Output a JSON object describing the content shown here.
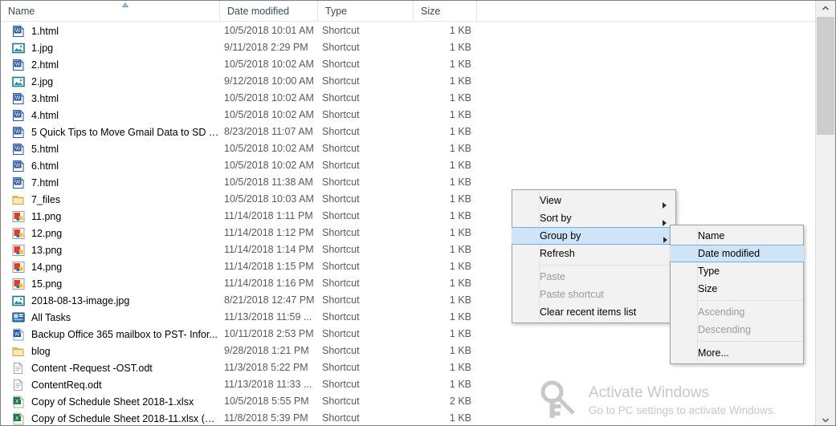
{
  "columns": [
    {
      "label": "Name",
      "key": "name"
    },
    {
      "label": "Date modified",
      "key": "date"
    },
    {
      "label": "Type",
      "key": "type"
    },
    {
      "label": "Size",
      "key": "size"
    }
  ],
  "sort": {
    "column": "Name",
    "direction": "ascending",
    "marker_icon": "sort-ascending-icon"
  },
  "files": [
    {
      "name": "1.html",
      "date": "10/5/2018 10:01 AM",
      "type": "Shortcut",
      "size": "1 KB",
      "icon": "word-html-icon"
    },
    {
      "name": "1.jpg",
      "date": "9/11/2018 2:29 PM",
      "type": "Shortcut",
      "size": "1 KB",
      "icon": "image-jpg-icon"
    },
    {
      "name": "2.html",
      "date": "10/5/2018 10:02 AM",
      "type": "Shortcut",
      "size": "1 KB",
      "icon": "word-html-icon"
    },
    {
      "name": "2.jpg",
      "date": "9/12/2018 10:00 AM",
      "type": "Shortcut",
      "size": "1 KB",
      "icon": "image-jpg-icon"
    },
    {
      "name": "3.html",
      "date": "10/5/2018 10:02 AM",
      "type": "Shortcut",
      "size": "1 KB",
      "icon": "word-html-icon"
    },
    {
      "name": "4.html",
      "date": "10/5/2018 10:02 AM",
      "type": "Shortcut",
      "size": "1 KB",
      "icon": "word-html-icon"
    },
    {
      "name": "5 Quick Tips to Move Gmail Data to SD C...",
      "date": "8/23/2018 11:07 AM",
      "type": "Shortcut",
      "size": "1 KB",
      "icon": "word-html-icon"
    },
    {
      "name": "5.html",
      "date": "10/5/2018 10:02 AM",
      "type": "Shortcut",
      "size": "1 KB",
      "icon": "word-html-icon"
    },
    {
      "name": "6.html",
      "date": "10/5/2018 10:02 AM",
      "type": "Shortcut",
      "size": "1 KB",
      "icon": "word-html-icon"
    },
    {
      "name": "7.html",
      "date": "10/5/2018 11:38 AM",
      "type": "Shortcut",
      "size": "1 KB",
      "icon": "word-html-icon"
    },
    {
      "name": "7_files",
      "date": "10/5/2018 10:03 AM",
      "type": "Shortcut",
      "size": "1 KB",
      "icon": "folder-icon"
    },
    {
      "name": "11.png",
      "date": "11/14/2018 1:11 PM",
      "type": "Shortcut",
      "size": "1 KB",
      "icon": "png-icon"
    },
    {
      "name": "12.png",
      "date": "11/14/2018 1:12 PM",
      "type": "Shortcut",
      "size": "1 KB",
      "icon": "png-icon"
    },
    {
      "name": "13.png",
      "date": "11/14/2018 1:14 PM",
      "type": "Shortcut",
      "size": "1 KB",
      "icon": "png-icon"
    },
    {
      "name": "14.png",
      "date": "11/14/2018 1:15 PM",
      "type": "Shortcut",
      "size": "1 KB",
      "icon": "png-icon"
    },
    {
      "name": "15.png",
      "date": "11/14/2018 1:16 PM",
      "type": "Shortcut",
      "size": "1 KB",
      "icon": "png-icon"
    },
    {
      "name": "2018-08-13-image.jpg",
      "date": "8/21/2018 12:47 PM",
      "type": "Shortcut",
      "size": "1 KB",
      "icon": "image-jpg-icon"
    },
    {
      "name": "All Tasks",
      "date": "11/13/2018 11:59 ...",
      "type": "Shortcut",
      "size": "1 KB",
      "icon": "console-icon"
    },
    {
      "name": "Backup Office 365 mailbox to PST- Infor...",
      "date": "10/11/2018 2:53 PM",
      "type": "Shortcut",
      "size": "1 KB",
      "icon": "word-doc-icon"
    },
    {
      "name": "blog",
      "date": "9/28/2018 1:21 PM",
      "type": "Shortcut",
      "size": "1 KB",
      "icon": "folder-icon"
    },
    {
      "name": "Content -Request -OST.odt",
      "date": "11/3/2018 5:22 PM",
      "type": "Shortcut",
      "size": "1 KB",
      "icon": "odt-icon"
    },
    {
      "name": "ContentReq.odt",
      "date": "11/13/2018 11:33 ...",
      "type": "Shortcut",
      "size": "1 KB",
      "icon": "odt-icon"
    },
    {
      "name": "Copy of Schedule Sheet 2018-1.xlsx",
      "date": "10/5/2018 5:55 PM",
      "type": "Shortcut",
      "size": "2 KB",
      "icon": "excel-icon"
    },
    {
      "name": "Copy of Schedule Sheet 2018-11.xlsx (9 n...",
      "date": "11/8/2018 5:39 PM",
      "type": "Shortcut",
      "size": "1 KB",
      "icon": "excel-icon"
    }
  ],
  "context_menu": {
    "items": [
      {
        "label": "View",
        "submenu": true,
        "disabled": false,
        "highlighted": false,
        "separator_after": false
      },
      {
        "label": "Sort by",
        "submenu": true,
        "disabled": false,
        "highlighted": false,
        "separator_after": false
      },
      {
        "label": "Group by",
        "submenu": true,
        "disabled": false,
        "highlighted": true,
        "separator_after": false
      },
      {
        "label": "Refresh",
        "submenu": false,
        "disabled": false,
        "highlighted": false,
        "separator_after": true
      },
      {
        "label": "Paste",
        "submenu": false,
        "disabled": true,
        "highlighted": false,
        "separator_after": false
      },
      {
        "label": "Paste shortcut",
        "submenu": false,
        "disabled": true,
        "highlighted": false,
        "separator_after": false
      },
      {
        "label": "Clear recent items list",
        "submenu": false,
        "disabled": false,
        "highlighted": false,
        "separator_after": false
      }
    ]
  },
  "submenu": {
    "items": [
      {
        "label": "Name",
        "disabled": false,
        "highlighted": false,
        "separator_after": false
      },
      {
        "label": "Date modified",
        "disabled": false,
        "highlighted": true,
        "separator_after": false
      },
      {
        "label": "Type",
        "disabled": false,
        "highlighted": false,
        "separator_after": false
      },
      {
        "label": "Size",
        "disabled": false,
        "highlighted": false,
        "separator_after": true
      },
      {
        "label": "Ascending",
        "disabled": true,
        "highlighted": false,
        "separator_after": false
      },
      {
        "label": "Descending",
        "disabled": true,
        "highlighted": false,
        "separator_after": true
      },
      {
        "label": "More...",
        "disabled": false,
        "highlighted": false,
        "separator_after": false
      }
    ]
  },
  "watermark": {
    "title": "Activate Windows",
    "subtitle": "Go to PC settings to activate Windows.",
    "icon": "key-icon",
    "color": "#c8c8c8"
  },
  "scrollbar": {
    "up_icon": "chevron-up-icon",
    "down_icon": "chevron-down-icon",
    "thumb_position": "top"
  },
  "colors": {
    "highlight_fill": "#cfe5f7",
    "highlight_border": "#70aedd",
    "header_text": "#3a4a5c",
    "secondary_text": "#5a5a5a"
  }
}
